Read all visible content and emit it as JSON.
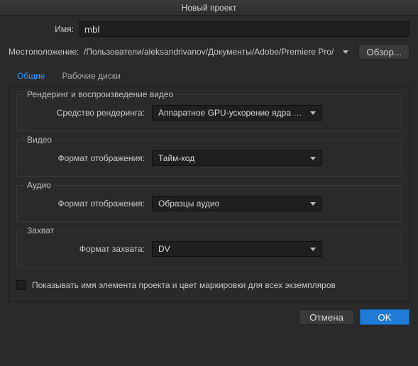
{
  "title": "Новый проект",
  "name_label": "Имя:",
  "name_value": "mbl",
  "location_label": "Местоположение:",
  "location_value": "/Пользователи/aleksandrivanov/Документы/Adobe/Premiere Pro/",
  "browse_label": "Обзор...",
  "tabs": {
    "general": "Общие",
    "scratch": "Рабочие диски"
  },
  "section_render": {
    "legend": "Рендеринг и воспроизведение видео",
    "renderer_label": "Средство рендеринга:",
    "renderer_value": "Аппаратное GPU-ускорение ядра Merc"
  },
  "section_video": {
    "legend": "Видео",
    "display_label": "Формат отображения:",
    "display_value": "Тайм-код"
  },
  "section_audio": {
    "legend": "Аудио",
    "display_label": "Формат отображения:",
    "display_value": "Образцы аудио"
  },
  "section_capture": {
    "legend": "Захват",
    "format_label": "Формат захвата:",
    "format_value": "DV"
  },
  "show_names_label": "Показывать имя элемента проекта и цвет маркировки для всех экземпляров",
  "footer": {
    "cancel": "Отмена",
    "ok": "OK"
  }
}
